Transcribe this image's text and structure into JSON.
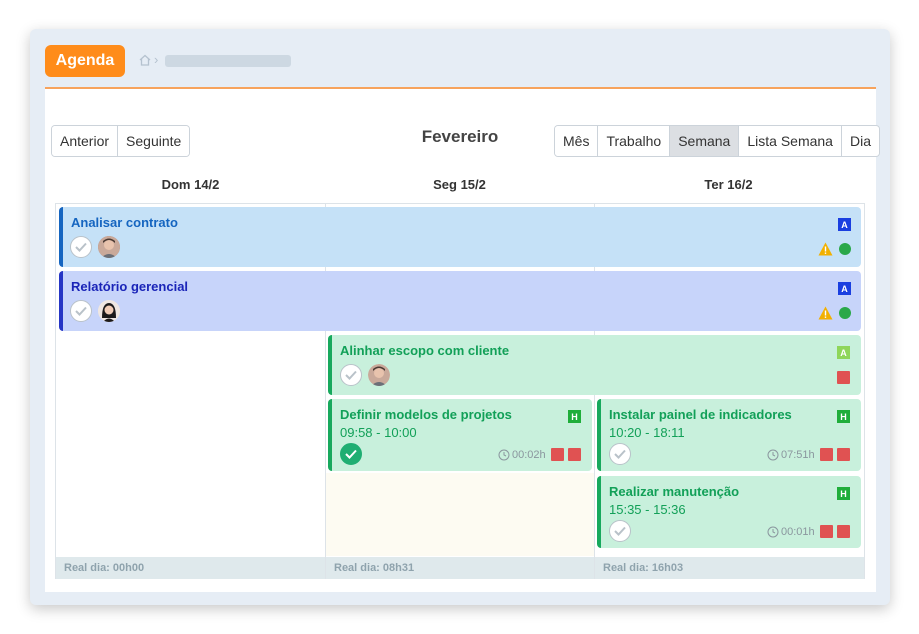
{
  "header": {
    "agenda_label": "Agenda"
  },
  "nav": {
    "prev_label": "Anterior",
    "next_label": "Seguinte",
    "month_title": "Fevereiro"
  },
  "views": {
    "month": "Mês",
    "work": "Trabalho",
    "week": "Semana",
    "week_list": "Lista Semana",
    "day": "Dia",
    "active": "Semana"
  },
  "days": [
    {
      "label": "Dom 14/2",
      "footer": "Real dia: 00h00"
    },
    {
      "label": "Seg 15/2",
      "footer": "Real dia: 08h31"
    },
    {
      "label": "Ter 16/2",
      "footer": "Real dia: 16h03"
    }
  ],
  "events": {
    "analisar": {
      "title": "Analisar contrato",
      "badge": "A",
      "color": "#c5e1f7",
      "accent": "#1565c0",
      "title_color": "#1565c0"
    },
    "relatorio": {
      "title": "Relatório gerencial",
      "badge": "A",
      "color": "#c7d4fa",
      "accent": "#2535c5",
      "title_color": "#1a24b8"
    },
    "alinhar": {
      "title": "Alinhar escopo com cliente",
      "badge": "A",
      "color": "#c8f0dc",
      "accent": "#17a95d",
      "title_color": "#12a058"
    },
    "definir": {
      "title": "Definir modelos de projetos",
      "time": "09:58 - 10:00",
      "badge": "H",
      "duration": "00:02h"
    },
    "instalar": {
      "title": "Instalar painel de indicadores",
      "time": "10:20 - 18:11",
      "badge": "H",
      "duration": "07:51h"
    },
    "realizar": {
      "title": "Realizar manutenção",
      "time": "15:35 - 15:36",
      "badge": "H",
      "duration": "00:01h"
    }
  },
  "colors": {
    "brand_orange": "#ff8c1a",
    "badge_blue": "#1a3fe0",
    "badge_green": "#1fae3a",
    "badge_lightgreen": "#8fd65a",
    "status_red": "#e05252",
    "status_green": "#2aa84a",
    "warn_yellow": "#f2b000"
  }
}
